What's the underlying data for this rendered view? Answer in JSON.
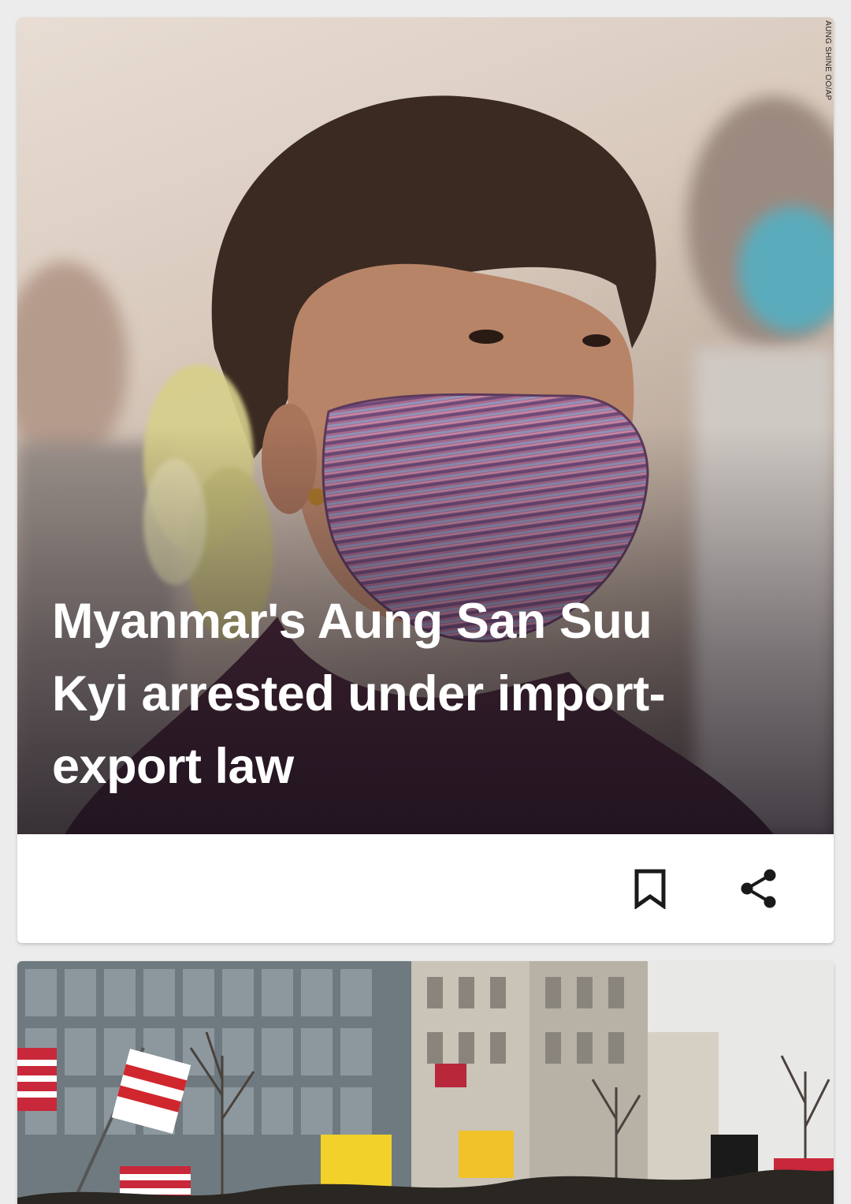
{
  "feed": {
    "cards": [
      {
        "headline": "Myanmar's Aung San Suu Kyi arrested under import-export law",
        "photo_credit": "AUNG SHINE OO/AP",
        "image_description": "woman-in-striped-face-mask",
        "actions": {
          "bookmark_icon": "bookmark-icon",
          "share_icon": "share-icon"
        }
      },
      {
        "image_description": "street-rally-with-flags"
      }
    ]
  },
  "colors": {
    "background": "#ececec",
    "card": "#ffffff",
    "headline_text": "#ffffff",
    "icon": "#1a1a1a"
  }
}
